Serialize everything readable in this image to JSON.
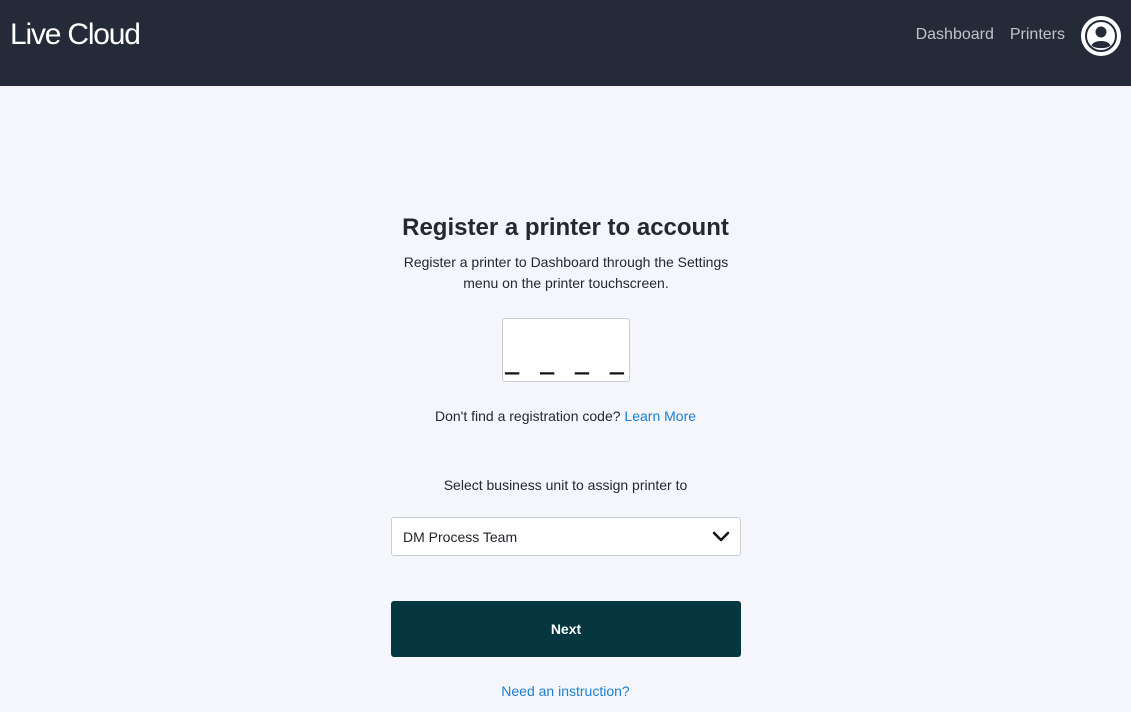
{
  "header": {
    "logo": "Live Cloud",
    "nav": [
      {
        "label": "Dashboard"
      },
      {
        "label": "Printers"
      }
    ],
    "avatar_icon": "user-circle-icon"
  },
  "main": {
    "title": "Register a printer to account",
    "description": "Register a printer to Dashboard through the Settings menu on the printer touchscreen.",
    "code_input": {
      "value": "_ _ _ _"
    },
    "hint_text": "Don't find a registration code?",
    "hint_link": "Learn More",
    "unit_label": "Select business unit to assign printer to",
    "unit_select": {
      "value": "DM Process Team",
      "icon": "chevron-down-icon"
    },
    "next_label": "Next",
    "instruction_link": "Need an instruction?"
  },
  "colors": {
    "header_bg": "#252a38",
    "page_bg": "#f4f6fb",
    "primary_button": "#063640",
    "link": "#1b7fd6"
  }
}
